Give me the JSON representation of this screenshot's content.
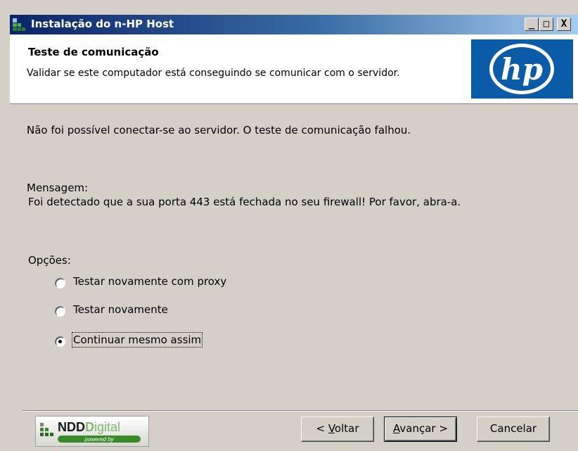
{
  "window": {
    "title": "Instalação do n-HP Host",
    "minimize_glyph": "_",
    "maximize_glyph": "□",
    "close_glyph": "X"
  },
  "header": {
    "title": "Teste de comunicação",
    "description": "Validar se este computador está conseguindo se comunicar com o servidor.",
    "logo_icon": "hp-logo",
    "logo_text": "hp"
  },
  "main": {
    "status": "Não foi possível conectar-se ao servidor. O teste de comunicação falhou.",
    "message_label": "Mensagem:",
    "message": "Foi detectado que a sua porta 443 está fechada no seu firewall! Por favor, abra-a.",
    "options_label": "Opções:",
    "options": [
      {
        "label": "Testar novamente com proxy",
        "selected": false
      },
      {
        "label": "Testar novamente",
        "selected": false
      },
      {
        "label": "Continuar mesmo assim",
        "selected": true
      }
    ]
  },
  "footer": {
    "brand_bold": "NDD",
    "brand_rest": "igital",
    "brand_d": "D",
    "tagline": "powered by",
    "buttons": {
      "back": {
        "prefix": "< ",
        "mnemonic": "V",
        "rest": "oltar"
      },
      "next": {
        "mnemonic": "A",
        "rest": "vançar >"
      },
      "cancel": "Cancelar"
    }
  },
  "colors": {
    "title_gradient_start": "#0a246a",
    "title_gradient_end": "#a6caf0",
    "dialog_face": "#d4d0c8",
    "hp_blue": "#0b5ca8",
    "ndd_green": "#3a8a2c"
  }
}
